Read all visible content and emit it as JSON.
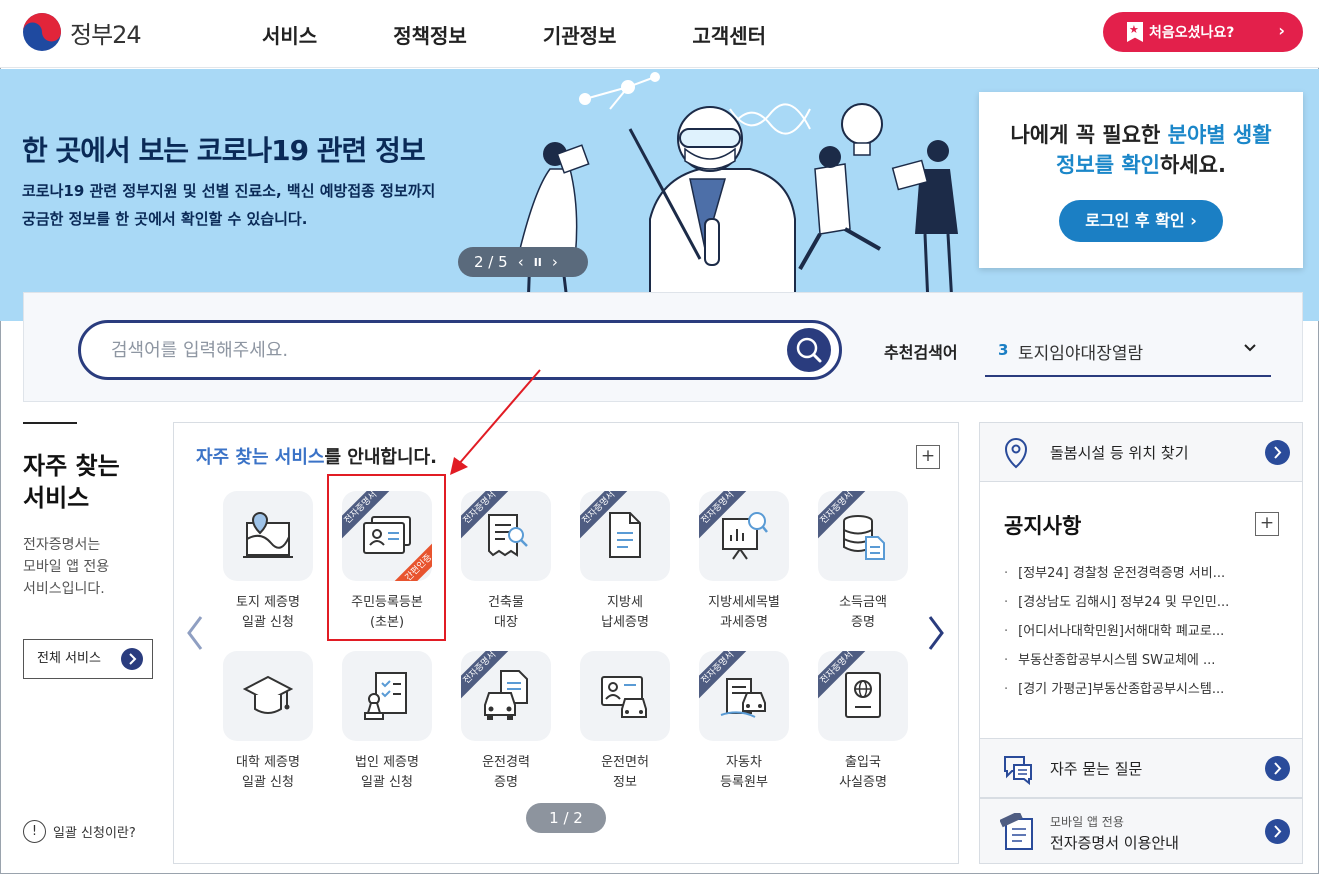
{
  "header": {
    "logo_text": "정부24",
    "nav": [
      "서비스",
      "정책정보",
      "기관정보",
      "고객센터"
    ],
    "first_visit": "처음오셨나요?",
    "first_visit_arrow": "›"
  },
  "banner": {
    "title": "한 곳에서 보는 코로나19 관련 정보",
    "desc_line1": "코로나19 관련 정부지원 및 선별 진료소, 백신 예방접종 정보까지",
    "desc_line2": "궁금한 정보를 한 곳에서 확인할 수 있습니다.",
    "pager": "2 / 5",
    "prev": "‹",
    "pause": "II",
    "next": "›",
    "login_text_a": "나에게 꼭 필요한 ",
    "login_text_hl1": "분야별 생활",
    "login_text_hl2": "정보를 확인",
    "login_text_b": "하세요.",
    "login_button": "로그인 후 확인 ›"
  },
  "search": {
    "placeholder": "검색어를 입력해주세요.",
    "rec_label": "추천검색어",
    "rec_num": "3",
    "rec_keyword": "토지임야대장열람"
  },
  "left": {
    "title_line1": "자주 찾는",
    "title_line2": "서비스",
    "desc_line1": "전자증명서는",
    "desc_line2": "모바일 앱 전용",
    "desc_line3": "서비스입니다.",
    "all_services": "전체 서비스",
    "help_q": "!",
    "help": "일괄 신청이란?"
  },
  "services": {
    "heading_blue": "자주 찾는 서비스",
    "heading_rest": "를 안내합니다.",
    "plus": "+",
    "ribbon": "전자증명서",
    "ribbon_red": "간편인증",
    "page": "1 / 2",
    "items": [
      {
        "label": "토지 제증명\n일괄 신청",
        "icon": "land-map-icon"
      },
      {
        "label": "주민등록등본\n(초본)",
        "icon": "id-card-icon"
      },
      {
        "label": "건축물\n대장",
        "icon": "building-document-icon"
      },
      {
        "label": "지방세\n납세증명",
        "icon": "tax-document-icon"
      },
      {
        "label": "지방세세목별\n과세증명",
        "icon": "chart-board-icon"
      },
      {
        "label": "소득금액\n증명",
        "icon": "coins-document-icon"
      },
      {
        "label": "대학 제증명\n일괄 신청",
        "icon": "graduation-cap-icon"
      },
      {
        "label": "법인 제증명\n일괄 신청",
        "icon": "stamp-checklist-icon"
      },
      {
        "label": "운전경력\n증명",
        "icon": "car-document-icon"
      },
      {
        "label": "운전면허\n정보",
        "icon": "license-car-icon"
      },
      {
        "label": "자동차\n등록원부",
        "icon": "car-registry-icon"
      },
      {
        "label": "출입국\n사실증명",
        "icon": "passport-icon"
      }
    ]
  },
  "right": {
    "facility": "돌봄시설 등 위치 찾기",
    "notice_title": "공지사항",
    "notice_plus": "+",
    "notices": [
      "[정부24] 경찰청 운전경력증명 서비...",
      "[경상남도 김해시] 정부24 및 무인민...",
      "[어디서나대학민원]서해대학 폐교로...",
      "부동산종합공부시스템 SW교체에 ...",
      "[경기 가평군]부동산종합공부시스템..."
    ],
    "faq": "자주 묻는 질문",
    "mobile_small": "모바일 앱 전용",
    "mobile_large": "전자증명서 이용안내"
  }
}
